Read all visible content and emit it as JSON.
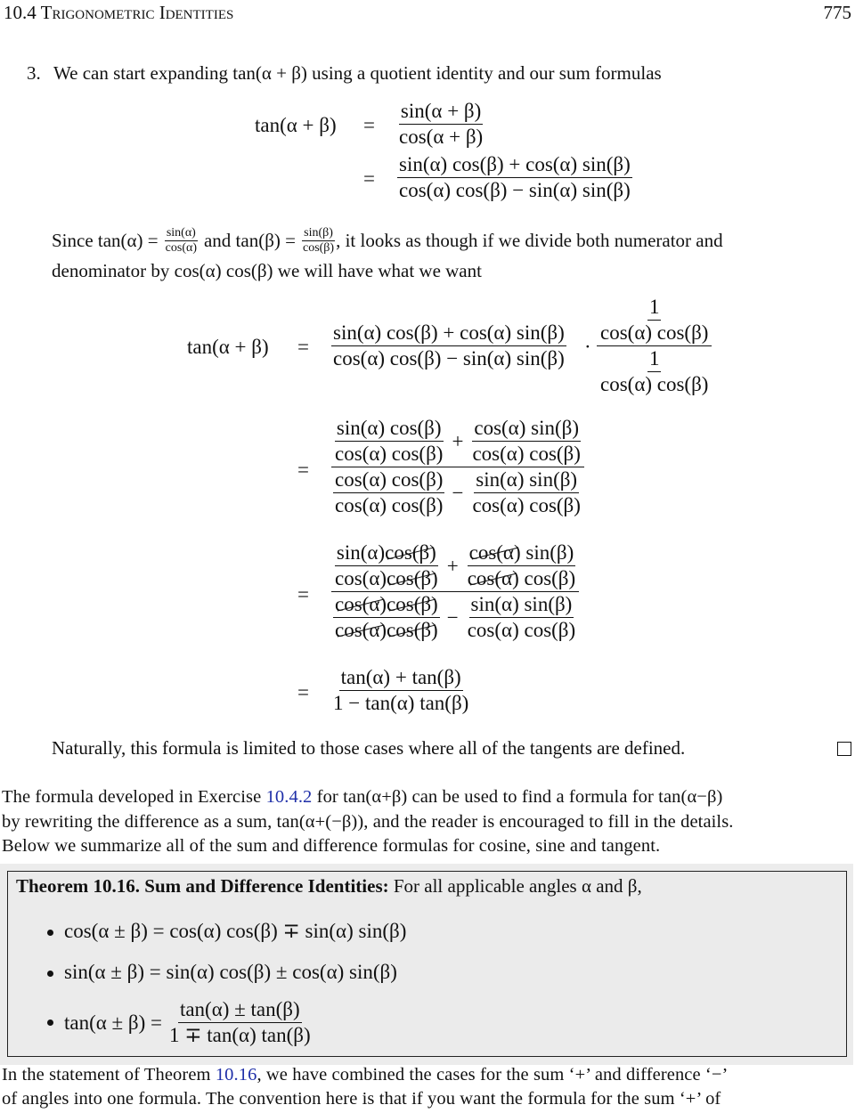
{
  "header": {
    "section": "10.4 Trigonometric Identities",
    "page_number": "775"
  },
  "item3": {
    "number": "3.",
    "intro": "We can start expanding tan(α + β) using a quotient identity and our sum formulas"
  },
  "eq1": {
    "lhs": "tan(α + β)",
    "eq": "=",
    "step1_num": "sin(α + β)",
    "step1_den": "cos(α + β)",
    "step2_num": "sin(α) cos(β) + cos(α) sin(β)",
    "step2_den": "cos(α) cos(β) − sin(α) sin(β)"
  },
  "since": {
    "lead": "Since tan(α) =",
    "f1_num": "sin(α)",
    "f1_den": "cos(α)",
    "mid": "and tan(β) =",
    "f2_num": "sin(β)",
    "f2_den": "cos(β)",
    "tail": ", it looks as though if we divide both numerator and",
    "line2": "denominator by cos(α) cos(β) we will have what we want"
  },
  "eq2": {
    "lhs": "tan(α + β)",
    "eq": "=",
    "num": "sin(α) cos(β) + cos(α) sin(β)",
    "den": "cos(α) cos(β) − sin(α) sin(β)",
    "dot": "·",
    "one": "1",
    "cc": "cos(α) cos(β)"
  },
  "eq3": {
    "eq": "=",
    "a_num": "sin(α) cos(β)",
    "a_den": "cos(α) cos(β)",
    "plus": "+",
    "b_num": "cos(α) sin(β)",
    "b_den": "cos(α) cos(β)",
    "c_num": "cos(α) cos(β)",
    "c_den": "cos(α) cos(β)",
    "minus": "−",
    "d_num": "sin(α) sin(β)",
    "d_den": "cos(α) cos(β)"
  },
  "eq4": {
    "eq": "=",
    "sin_a": "sin(α)",
    "cos_a": "cos(α)",
    "cos_b": "cos(β)",
    "sin_b": "sin(β)",
    "sin_a_sin_b": "sin(α) sin(β)",
    "cos_a_cos_b": "cos(α) cos(β)",
    "plus": "+",
    "minus": "−"
  },
  "eq5": {
    "eq": "=",
    "num": "tan(α) + tan(β)",
    "den": "1 − tan(α) tan(β)"
  },
  "closing": "Naturally, this formula is limited to those cases where all of the tangents are defined.",
  "paragraph1": {
    "l1_a": "The formula developed in Exercise",
    "l1_link": "10.4.2",
    "l1_b": "for tan(α+β) can be used to find a formula for tan(α−β)",
    "l2": "by rewriting the difference as a sum, tan(α+(−β)), and the reader is encouraged to fill in the details.",
    "l3": "Below we summarize all of the sum and difference formulas for cosine, sine and tangent."
  },
  "theorem": {
    "label": "Theorem 10.16. Sum and Difference Identities:",
    "statement": "For all applicable angles α and β,",
    "items": [
      "cos(α ± β) = cos(α) cos(β) ∓ sin(α) sin(β)",
      "sin(α ± β) = sin(α) cos(β) ± cos(α) sin(β)"
    ],
    "tan_lhs": "tan(α ± β) =",
    "tan_num": "tan(α) ± tan(β)",
    "tan_den": "1 ∓ tan(α) tan(β)"
  },
  "paragraph2": {
    "l1_a": "In the statement of Theorem",
    "l1_link": "10.16",
    "l1_b": ", we have combined the cases for the sum ‘+’ and difference ‘−’",
    "l2": "of angles into one formula. The convention here is that if you want the formula for the sum ‘+’ of"
  },
  "colors": {
    "link": "#1f2fa8",
    "theorem_background": "#ebebeb",
    "text": "#111111"
  }
}
